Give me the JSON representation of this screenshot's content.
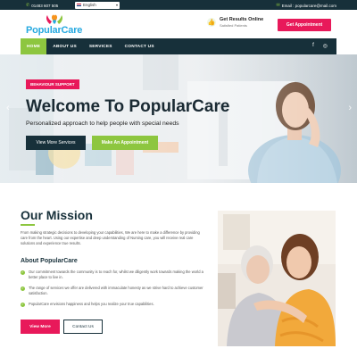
{
  "topbar": {
    "phone": "01483 607 505",
    "language": "English",
    "email": "Email : popularcare@mail.com"
  },
  "header": {
    "logo_text": "PopularCare",
    "results_title": "Get Results Online",
    "results_sub": "Satisfied Patients",
    "appointment_label": "Get Appointment"
  },
  "nav": {
    "items": [
      "HOME",
      "ABOUT US",
      "SERVICES",
      "CONTACT US"
    ],
    "social_facebook": "f",
    "social_instagram": "◎"
  },
  "hero": {
    "badge": "BEHAVIOUR SUPPORT",
    "title": "Welcome To PopularCare",
    "subtitle": "Personalized approach to help people with special needs",
    "btn_services": "View More Services",
    "btn_appointment": "Make An Appointment"
  },
  "mission": {
    "title": "Our Mission",
    "text": "From making strategic decisions to developing your capabilities, We are here to make a difference by providing care from the heart. Using our expertise and deep understanding of Nursing care, you will receive real care solutions and experience true results.",
    "about_title": "About PopularCare",
    "points": [
      "Our commitment towards the community is to reach for, whilst we diligently work towards making the world a better place to live in.",
      "The range of services we offer are delivered with immaculate honesty as we strive hard to achieve customer satisfaction.",
      "PopularCare envisions happiness and helps you realize your true capabilities."
    ],
    "btn_more": "View More",
    "btn_contact": "Contact Us"
  },
  "icons": {
    "phone": "phone-icon",
    "email": "email-icon",
    "thumb": "thumbs-up-icon",
    "check": "check-icon"
  },
  "colors": {
    "navy": "#17303a",
    "green": "#8dc63f",
    "pink": "#e8195a",
    "blue": "#26a9e0"
  }
}
